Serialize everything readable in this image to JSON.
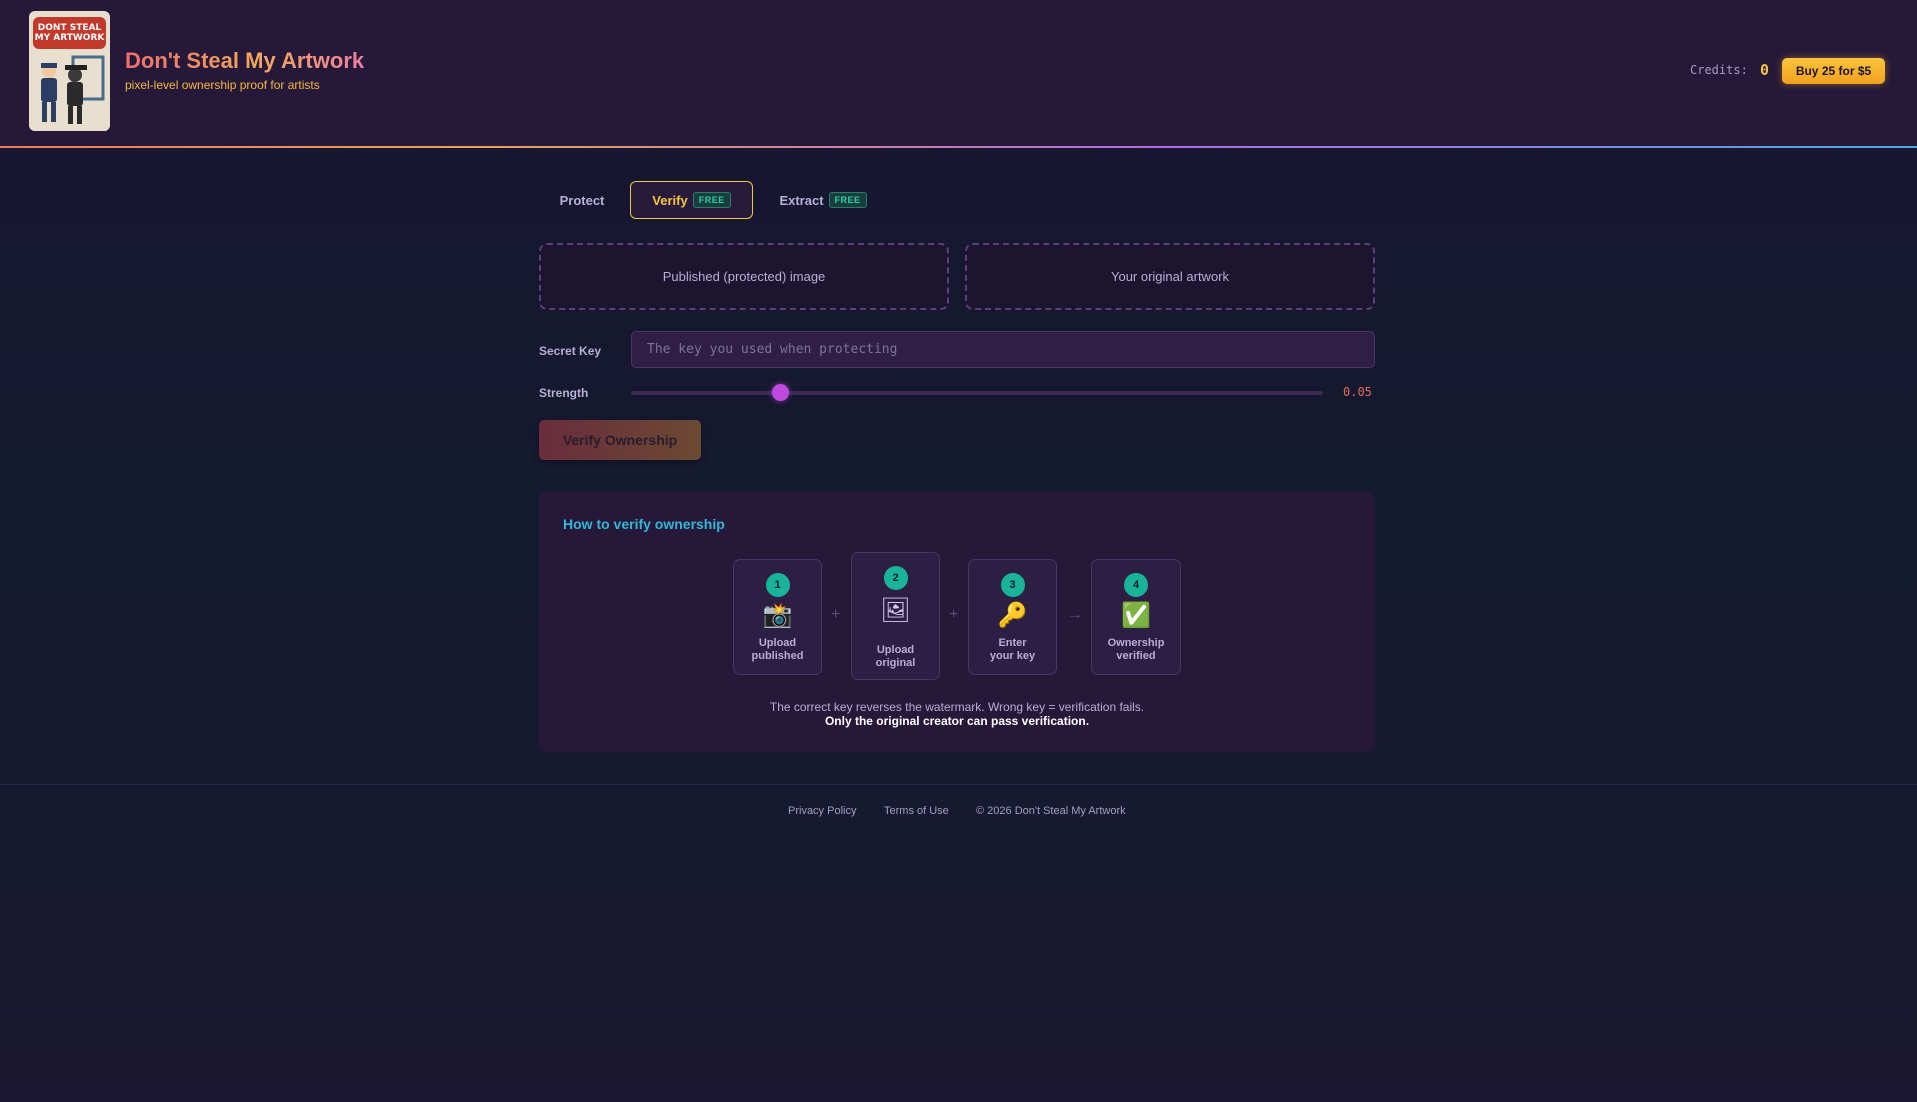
{
  "header": {
    "logo_text": "DONT STEAL MY ARTWORK",
    "title": "Don't Steal My Artwork",
    "subtitle": "pixel-level ownership proof for artists",
    "credits_label": "Credits:",
    "credits_value": "0",
    "buy_label": "Buy 25 for $5"
  },
  "tabs": [
    {
      "label": "Protect",
      "badge": ""
    },
    {
      "label": "Verify",
      "badge": "FREE",
      "active": true
    },
    {
      "label": "Extract",
      "badge": "FREE"
    }
  ],
  "upload": {
    "published_label": "Published (protected) image",
    "original_label": "Your original artwork"
  },
  "form": {
    "key_label": "Secret Key",
    "key_placeholder": "The key you used when protecting",
    "strength_label": "Strength",
    "strength_value": "0.05",
    "submit_label": "Verify Ownership"
  },
  "howto": {
    "title": "How to verify ownership",
    "steps": [
      {
        "num": "1",
        "icon": "📸",
        "icon_name": "camera-icon",
        "line1": "Upload",
        "line2": "published"
      },
      {
        "num": "2",
        "icon": "🖼",
        "icon_name": "picture-frame-icon",
        "line1": "Upload",
        "line2": "original"
      },
      {
        "num": "3",
        "icon": "🔑",
        "icon_name": "key-icon",
        "line1": "Enter",
        "line2": "your key"
      },
      {
        "num": "4",
        "icon": "✅",
        "icon_name": "check-icon",
        "line1": "Ownership",
        "line2": "verified"
      }
    ],
    "connectors": [
      "+",
      "+",
      "→"
    ],
    "note": "The correct key reverses the watermark. Wrong key = verification fails.",
    "note_strong": "Only the original creator can pass verification."
  },
  "footer": {
    "privacy": "Privacy Policy",
    "terms": "Terms of Use",
    "copyright": "© 2026 Don't Steal My Artwork"
  },
  "colors": {
    "accent_gold": "#f5c542",
    "accent_teal": "#19b39a",
    "accent_purple": "#c04ae0",
    "header_bg": "#251838"
  }
}
